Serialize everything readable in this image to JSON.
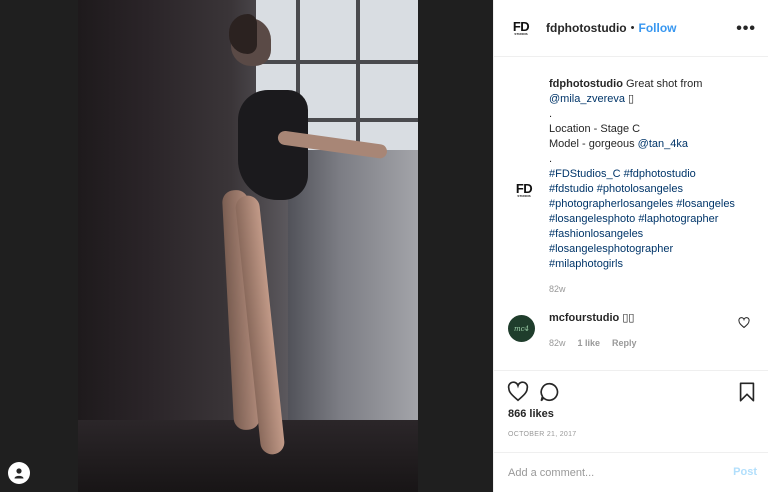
{
  "header": {
    "logo_text": "FD",
    "logo_subtext": "STUDIOS",
    "username": "fdphotostudio",
    "separator": "•",
    "follow_label": "Follow",
    "more_label": "•••"
  },
  "caption": {
    "username": "fdphotostudio",
    "line1": "Great shot from",
    "mention_photographer": "@mila_zvereva",
    "emoji": "▯",
    "dot1": ".",
    "location": "Location - Stage C",
    "model_prefix": "Model - gorgeous",
    "mention_model": "@tan_4ka",
    "dot2": ".",
    "hashtags": [
      "#FDStudios_C",
      "#fdphotostudio",
      "#fdstudio",
      "#photolosangeles",
      "#photographerlosangeles",
      "#losangeles",
      "#losangelesphoto",
      "#laphotographer",
      "#fashionlosangeles",
      "#losangelesphotographer",
      "#milaphotogirls"
    ],
    "time": "82w"
  },
  "comment": {
    "avatar_text": "mc4",
    "username": "mcfourstudio",
    "text": "▯▯",
    "time": "82w",
    "likes": "1 like",
    "reply_label": "Reply"
  },
  "actions": {
    "likes_count": "866 likes",
    "date": "OCTOBER 21, 2017"
  },
  "add_comment": {
    "placeholder": "Add a comment...",
    "post_label": "Post"
  },
  "colors": {
    "link": "#3897f0",
    "hashtag": "#003569",
    "muted": "#999999",
    "post_disabled": "#b2dffc"
  },
  "icons": [
    "user-tag-icon",
    "more-options-icon",
    "heart-icon",
    "comment-icon",
    "bookmark-icon",
    "small-heart-icon"
  ]
}
